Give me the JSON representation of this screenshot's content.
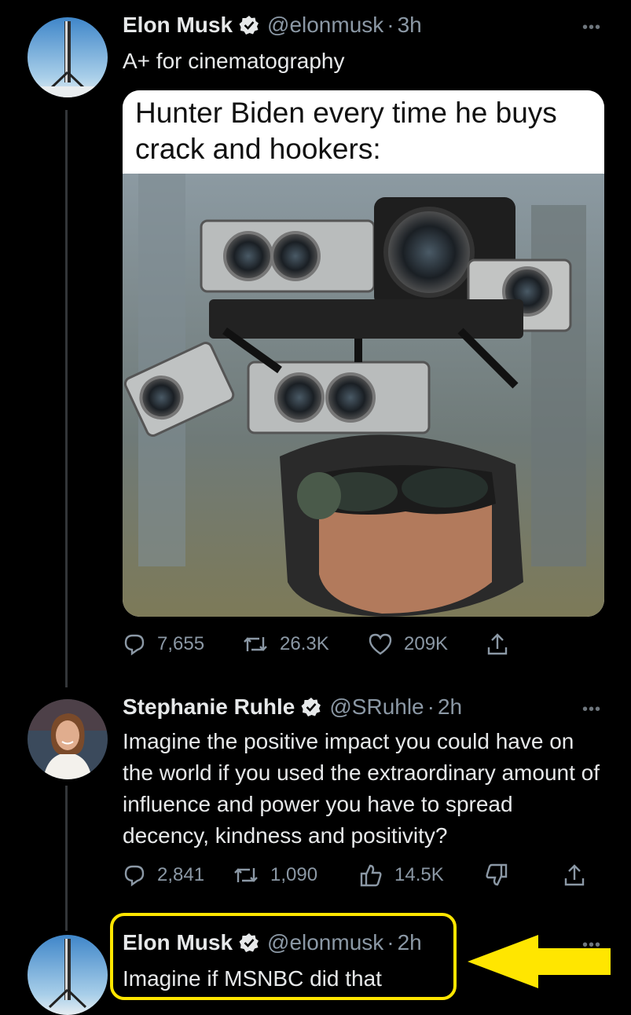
{
  "tweets": [
    {
      "name": "Elon Musk",
      "handle": "@elonmusk",
      "sep": "·",
      "time": "3h",
      "text": "A+ for cinematography",
      "media_caption": "Hunter Biden every time he buys crack and hookers:",
      "replies": "7,655",
      "retweets": "26.3K",
      "likes": "209K"
    },
    {
      "name": "Stephanie Ruhle",
      "handle": "@SRuhle",
      "sep": "·",
      "time": "2h",
      "text": "Imagine the positive impact you could have on the world if you used the extraordinary amount of influence and power you have to spread decency, kindness and positivity?",
      "replies": "2,841",
      "retweets": "1,090",
      "likes": "14.5K"
    },
    {
      "name": "Elon Musk",
      "handle": "@elonmusk",
      "sep": "·",
      "time": "2h",
      "text": "Imagine if MSNBC did that"
    }
  ],
  "more_label": "•••",
  "colors": {
    "highlight": "#ffe600",
    "verified": "#e7e9ea",
    "muted": "#8b98a5"
  },
  "icons": [
    "reply-icon",
    "retweet-icon",
    "like-icon",
    "share-icon",
    "dislike-icon",
    "verified-icon",
    "more-icon",
    "arrow-pointer"
  ]
}
